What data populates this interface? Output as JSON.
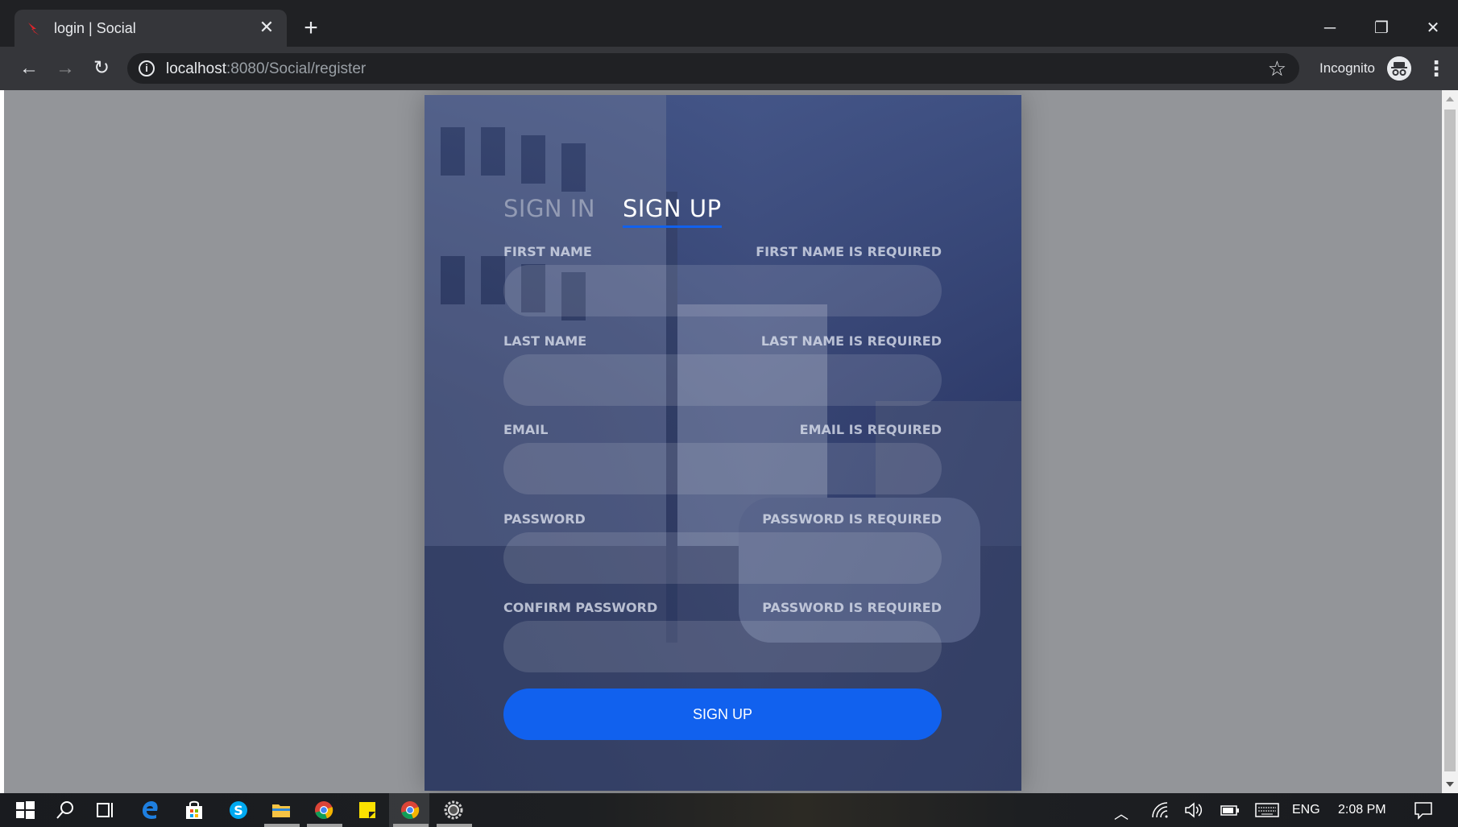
{
  "browser": {
    "tab_title": "login | Social",
    "new_tab_icon": "plus-icon",
    "url_host": "localhost",
    "url_path": ":8080/Social/register",
    "incognito_label": "Incognito",
    "window_controls": [
      "minimize-icon",
      "restore-icon",
      "close-icon"
    ]
  },
  "page": {
    "tabs": [
      {
        "label": "SIGN IN",
        "active": false
      },
      {
        "label": "SIGN UP",
        "active": true
      }
    ],
    "fields": [
      {
        "label": "FIRST NAME",
        "error": "FIRST NAME IS REQUIRED",
        "value": ""
      },
      {
        "label": "LAST NAME",
        "error": "LAST NAME IS REQUIRED",
        "value": ""
      },
      {
        "label": "EMAIL",
        "error": "EMAIL IS REQUIRED",
        "value": ""
      },
      {
        "label": "PASSWORD",
        "error": "PASSWORD IS REQUIRED",
        "value": ""
      },
      {
        "label": "CONFIRM PASSWORD",
        "error": "PASSWORD IS REQUIRED",
        "value": ""
      }
    ],
    "submit_label": "SIGN UP",
    "colors": {
      "accent": "#1161ee",
      "overlay": "#3e5084",
      "page_bg": "#939599"
    }
  },
  "taskbar": {
    "language": "ENG",
    "time": "2:08 PM",
    "icons": [
      "windows-start-icon",
      "search-icon",
      "task-view-icon",
      "edge-icon",
      "store-icon",
      "skype-icon",
      "file-explorer-icon",
      "chrome-icon",
      "sticky-notes-icon",
      "chrome-active-icon",
      "settings-icon"
    ]
  }
}
